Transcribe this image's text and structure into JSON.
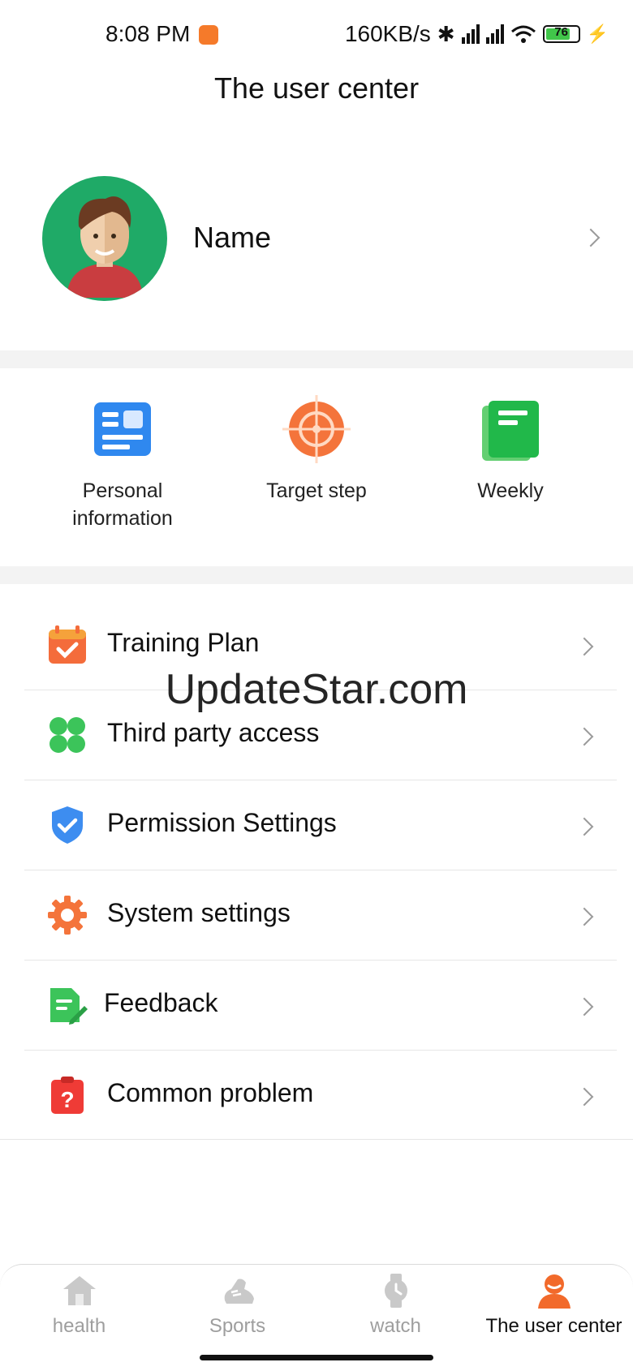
{
  "status_bar": {
    "time": "8:08 PM",
    "speed": "160KB/s",
    "battery": "76"
  },
  "header": {
    "title": "The user center"
  },
  "profile": {
    "name": "Name"
  },
  "quick_actions": [
    {
      "label": "Personal\ninformation",
      "icon": "id-card-icon",
      "color": "#2f88ef"
    },
    {
      "label": "Target step",
      "icon": "target-icon",
      "color": "#f4743b"
    },
    {
      "label": "Weekly",
      "icon": "book-icon",
      "color": "#21b84a"
    }
  ],
  "menu": {
    "items": [
      {
        "label": "Training Plan",
        "icon": "calendar-check-icon"
      },
      {
        "label": "Third party access",
        "icon": "clover-icon"
      },
      {
        "label": "Permission Settings",
        "icon": "shield-check-icon"
      },
      {
        "label": "System settings",
        "icon": "gear-icon"
      },
      {
        "label": "Feedback",
        "icon": "edit-document-icon"
      },
      {
        "label": "Common problem",
        "icon": "question-clipboard-icon"
      }
    ]
  },
  "watermark": "UpdateStar.com",
  "tabs": [
    {
      "label": "health",
      "icon": "home-icon"
    },
    {
      "label": "Sports",
      "icon": "shoe-icon"
    },
    {
      "label": "watch",
      "icon": "watch-icon"
    },
    {
      "label": "The user center",
      "icon": "user-icon",
      "active": true
    }
  ],
  "colors": {
    "accent": "#f26a2b",
    "inactive": "#c9c9c9",
    "separator": "#f3f3f3"
  }
}
